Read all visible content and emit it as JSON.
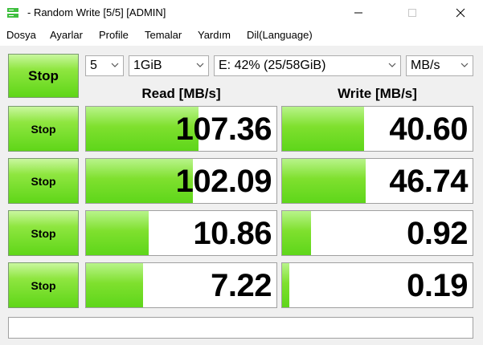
{
  "window": {
    "title": "- Random Write [5/5] [ADMIN]"
  },
  "menu": [
    "Dosya",
    "Ayarlar",
    "Profile",
    "Temalar",
    "Yardım",
    "Dil(Language)"
  ],
  "toolbar": {
    "stop_label": "Stop",
    "count": "5",
    "size": "1GiB",
    "drive": "E: 42% (25/58GiB)",
    "unit": "MB/s"
  },
  "headers": {
    "read": "Read [MB/s]",
    "write": "Write [MB/s]"
  },
  "rows": [
    {
      "button": "Stop",
      "read": "107.36",
      "write": "40.60",
      "read_fill": 0.59,
      "write_fill": 0.43
    },
    {
      "button": "Stop",
      "read": "102.09",
      "write": "46.74",
      "read_fill": 0.56,
      "write_fill": 0.44
    },
    {
      "button": "Stop",
      "read": "10.86",
      "write": "0.92",
      "read_fill": 0.33,
      "write_fill": 0.15
    },
    {
      "button": "Stop",
      "read": "7.22",
      "write": "0.19",
      "read_fill": 0.3,
      "write_fill": 0.04
    }
  ],
  "status": "",
  "colors": {
    "accent_green": "#5ed61a",
    "button_green": "#8fe640"
  }
}
